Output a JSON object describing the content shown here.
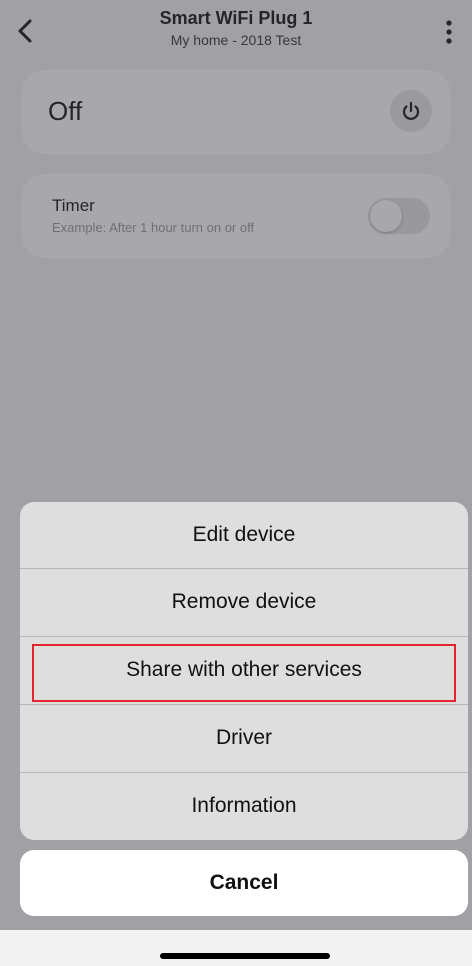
{
  "header": {
    "title": "Smart WiFi Plug 1",
    "subtitle": "My home - 2018 Test",
    "back_icon": "chevron-left-icon",
    "menu_icon": "more-vertical-icon"
  },
  "power": {
    "state_label": "Off",
    "icon": "power-icon"
  },
  "timer": {
    "label": "Timer",
    "description": "Example: After 1 hour turn on or off",
    "enabled": false
  },
  "action_sheet": {
    "items": [
      {
        "label": "Edit device"
      },
      {
        "label": "Remove device"
      },
      {
        "label": "Share with other services"
      },
      {
        "label": "Driver"
      },
      {
        "label": "Information"
      }
    ],
    "highlighted_item": "Share with other services",
    "highlight_color": "#e2262b",
    "cancel_label": "Cancel"
  }
}
